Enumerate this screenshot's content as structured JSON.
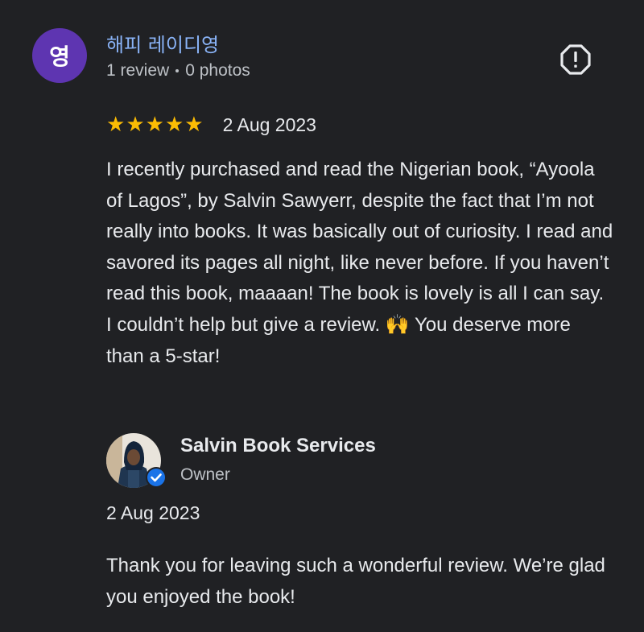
{
  "reviewer": {
    "initial": "영",
    "name": "해피 레이디영",
    "reviews": "1 review",
    "photos": "0 photos"
  },
  "report": {
    "icon": "report-flag-icon"
  },
  "review": {
    "rating": 5,
    "stars": [
      "★",
      "★",
      "★",
      "★",
      "★"
    ],
    "date": "2 Aug 2023",
    "text": "I recently purchased and read the Nigerian book, “Ayoola of Lagos”, by Salvin Sawyerr, despite the fact that I’m not really into books. It was basically out of curiosity. I read and savored its pages all night, like never before. If you haven’t read this book, maaaan! The book is lovely is all I can say. I couldn’t help but give a review. 🙌 You deserve more than a 5-star!"
  },
  "owner_response": {
    "name": "Salvin Book Services",
    "role": "Owner",
    "date": "2 Aug 2023",
    "text": "Thank you for leaving such a wonderful review. We’re glad you enjoyed the book!"
  },
  "colors": {
    "background": "#202124",
    "reviewer_avatar": "#5e35b1",
    "reviewer_name": "#8ab4f8",
    "star": "#fbbc04",
    "verified_badge": "#1a73e8"
  }
}
